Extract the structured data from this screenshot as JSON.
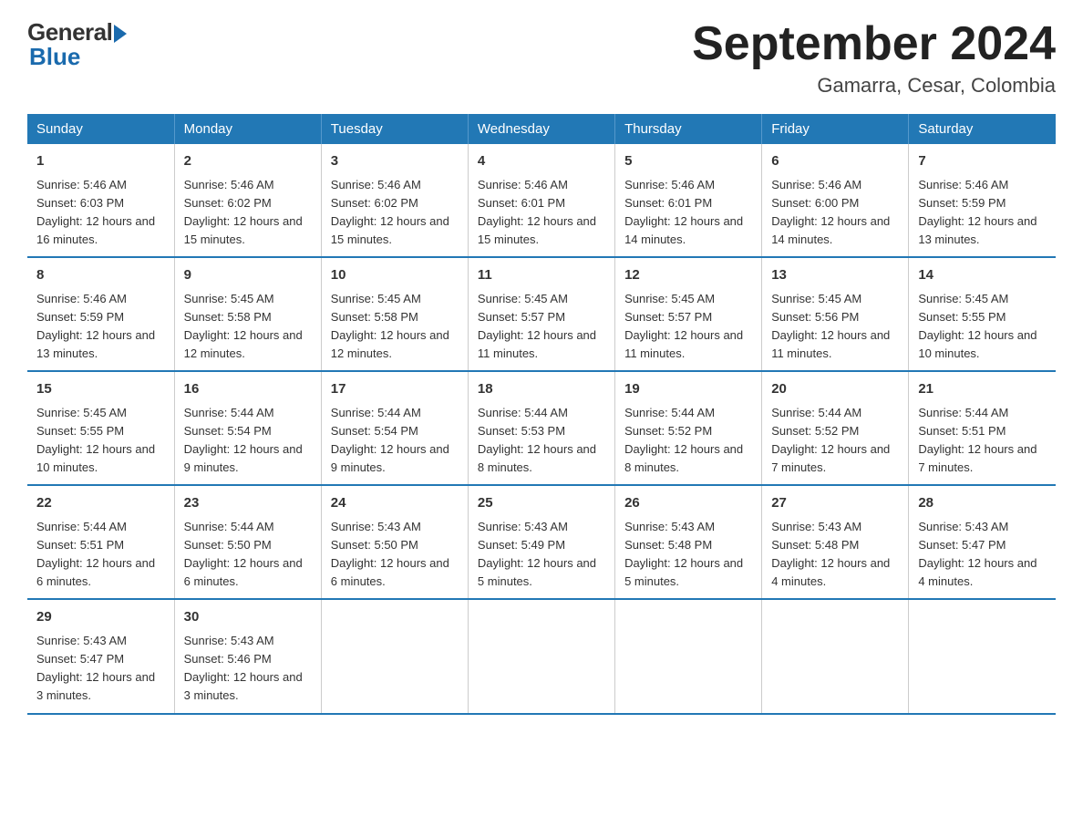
{
  "logo": {
    "general": "General",
    "blue": "Blue"
  },
  "title": "September 2024",
  "subtitle": "Gamarra, Cesar, Colombia",
  "days_of_week": [
    "Sunday",
    "Monday",
    "Tuesday",
    "Wednesday",
    "Thursday",
    "Friday",
    "Saturday"
  ],
  "weeks": [
    [
      {
        "day": "1",
        "sunrise": "5:46 AM",
        "sunset": "6:03 PM",
        "daylight": "12 hours and 16 minutes."
      },
      {
        "day": "2",
        "sunrise": "5:46 AM",
        "sunset": "6:02 PM",
        "daylight": "12 hours and 15 minutes."
      },
      {
        "day": "3",
        "sunrise": "5:46 AM",
        "sunset": "6:02 PM",
        "daylight": "12 hours and 15 minutes."
      },
      {
        "day": "4",
        "sunrise": "5:46 AM",
        "sunset": "6:01 PM",
        "daylight": "12 hours and 15 minutes."
      },
      {
        "day": "5",
        "sunrise": "5:46 AM",
        "sunset": "6:01 PM",
        "daylight": "12 hours and 14 minutes."
      },
      {
        "day": "6",
        "sunrise": "5:46 AM",
        "sunset": "6:00 PM",
        "daylight": "12 hours and 14 minutes."
      },
      {
        "day": "7",
        "sunrise": "5:46 AM",
        "sunset": "5:59 PM",
        "daylight": "12 hours and 13 minutes."
      }
    ],
    [
      {
        "day": "8",
        "sunrise": "5:46 AM",
        "sunset": "5:59 PM",
        "daylight": "12 hours and 13 minutes."
      },
      {
        "day": "9",
        "sunrise": "5:45 AM",
        "sunset": "5:58 PM",
        "daylight": "12 hours and 12 minutes."
      },
      {
        "day": "10",
        "sunrise": "5:45 AM",
        "sunset": "5:58 PM",
        "daylight": "12 hours and 12 minutes."
      },
      {
        "day": "11",
        "sunrise": "5:45 AM",
        "sunset": "5:57 PM",
        "daylight": "12 hours and 11 minutes."
      },
      {
        "day": "12",
        "sunrise": "5:45 AM",
        "sunset": "5:57 PM",
        "daylight": "12 hours and 11 minutes."
      },
      {
        "day": "13",
        "sunrise": "5:45 AM",
        "sunset": "5:56 PM",
        "daylight": "12 hours and 11 minutes."
      },
      {
        "day": "14",
        "sunrise": "5:45 AM",
        "sunset": "5:55 PM",
        "daylight": "12 hours and 10 minutes."
      }
    ],
    [
      {
        "day": "15",
        "sunrise": "5:45 AM",
        "sunset": "5:55 PM",
        "daylight": "12 hours and 10 minutes."
      },
      {
        "day": "16",
        "sunrise": "5:44 AM",
        "sunset": "5:54 PM",
        "daylight": "12 hours and 9 minutes."
      },
      {
        "day": "17",
        "sunrise": "5:44 AM",
        "sunset": "5:54 PM",
        "daylight": "12 hours and 9 minutes."
      },
      {
        "day": "18",
        "sunrise": "5:44 AM",
        "sunset": "5:53 PM",
        "daylight": "12 hours and 8 minutes."
      },
      {
        "day": "19",
        "sunrise": "5:44 AM",
        "sunset": "5:52 PM",
        "daylight": "12 hours and 8 minutes."
      },
      {
        "day": "20",
        "sunrise": "5:44 AM",
        "sunset": "5:52 PM",
        "daylight": "12 hours and 7 minutes."
      },
      {
        "day": "21",
        "sunrise": "5:44 AM",
        "sunset": "5:51 PM",
        "daylight": "12 hours and 7 minutes."
      }
    ],
    [
      {
        "day": "22",
        "sunrise": "5:44 AM",
        "sunset": "5:51 PM",
        "daylight": "12 hours and 6 minutes."
      },
      {
        "day": "23",
        "sunrise": "5:44 AM",
        "sunset": "5:50 PM",
        "daylight": "12 hours and 6 minutes."
      },
      {
        "day": "24",
        "sunrise": "5:43 AM",
        "sunset": "5:50 PM",
        "daylight": "12 hours and 6 minutes."
      },
      {
        "day": "25",
        "sunrise": "5:43 AM",
        "sunset": "5:49 PM",
        "daylight": "12 hours and 5 minutes."
      },
      {
        "day": "26",
        "sunrise": "5:43 AM",
        "sunset": "5:48 PM",
        "daylight": "12 hours and 5 minutes."
      },
      {
        "day": "27",
        "sunrise": "5:43 AM",
        "sunset": "5:48 PM",
        "daylight": "12 hours and 4 minutes."
      },
      {
        "day": "28",
        "sunrise": "5:43 AM",
        "sunset": "5:47 PM",
        "daylight": "12 hours and 4 minutes."
      }
    ],
    [
      {
        "day": "29",
        "sunrise": "5:43 AM",
        "sunset": "5:47 PM",
        "daylight": "12 hours and 3 minutes."
      },
      {
        "day": "30",
        "sunrise": "5:43 AM",
        "sunset": "5:46 PM",
        "daylight": "12 hours and 3 minutes."
      },
      null,
      null,
      null,
      null,
      null
    ]
  ]
}
